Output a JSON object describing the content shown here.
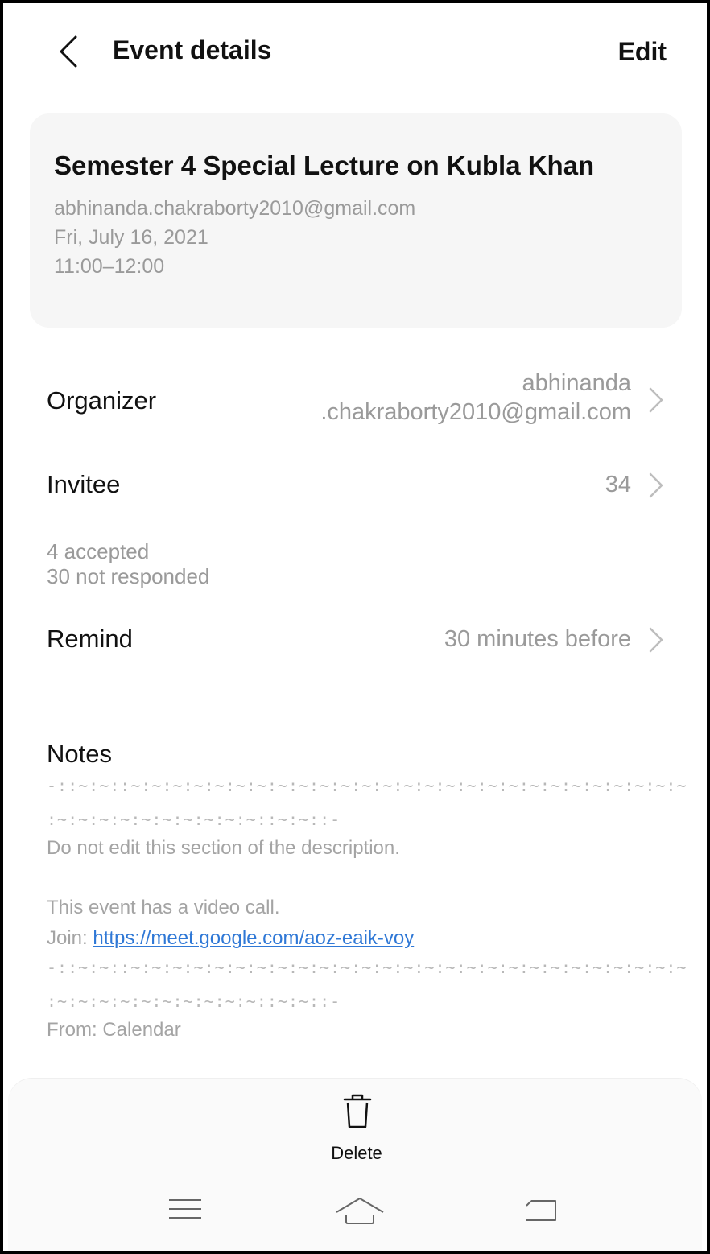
{
  "header": {
    "title": "Event details",
    "edit_label": "Edit"
  },
  "event": {
    "title": "Semester 4 Special Lecture on Kubla Khan",
    "account": "abhinanda.chakraborty2010@gmail.com",
    "date": "Fri, July 16, 2021",
    "time": "11:00–12:00"
  },
  "organizer": {
    "label": "Organizer",
    "value_line1": "abhinanda",
    "value_line2": ".chakraborty2010@gmail.com"
  },
  "invitee": {
    "label": "Invitee",
    "count": "34",
    "accepted": "4 accepted",
    "not_responded": "30 not responded"
  },
  "remind": {
    "label": "Remind",
    "value": "30 minutes before"
  },
  "notes": {
    "title": "Notes",
    "separator1": "-::~:~::~:~:~:~:~:~:~:~:~:~:~:~:~:~:~:~:~:~:~:~:~:~:~:~:~:~:~",
    "separator2": ":~:~:~:~:~:~:~:~:~:~::~:~::-",
    "warning": "Do not edit this section of the description.",
    "video_call": "This event has a video call.",
    "join_label": "Join: ",
    "join_link": "https://meet.google.com/aoz-eaik-voy",
    "separator3": "-::~:~::~:~:~:~:~:~:~:~:~:~:~:~:~:~:~:~:~:~:~:~:~:~:~:~:~:~:~",
    "separator4": ":~:~:~:~:~:~:~:~:~:~::~:~::-",
    "from": "From: Calendar"
  },
  "bottom": {
    "delete_label": "Delete"
  },
  "icons": {
    "back": "chevron-left-icon",
    "chevron": "chevron-right-icon",
    "delete": "trash-icon",
    "menu": "menu-icon",
    "home": "home-icon",
    "back_nav": "back-icon"
  }
}
